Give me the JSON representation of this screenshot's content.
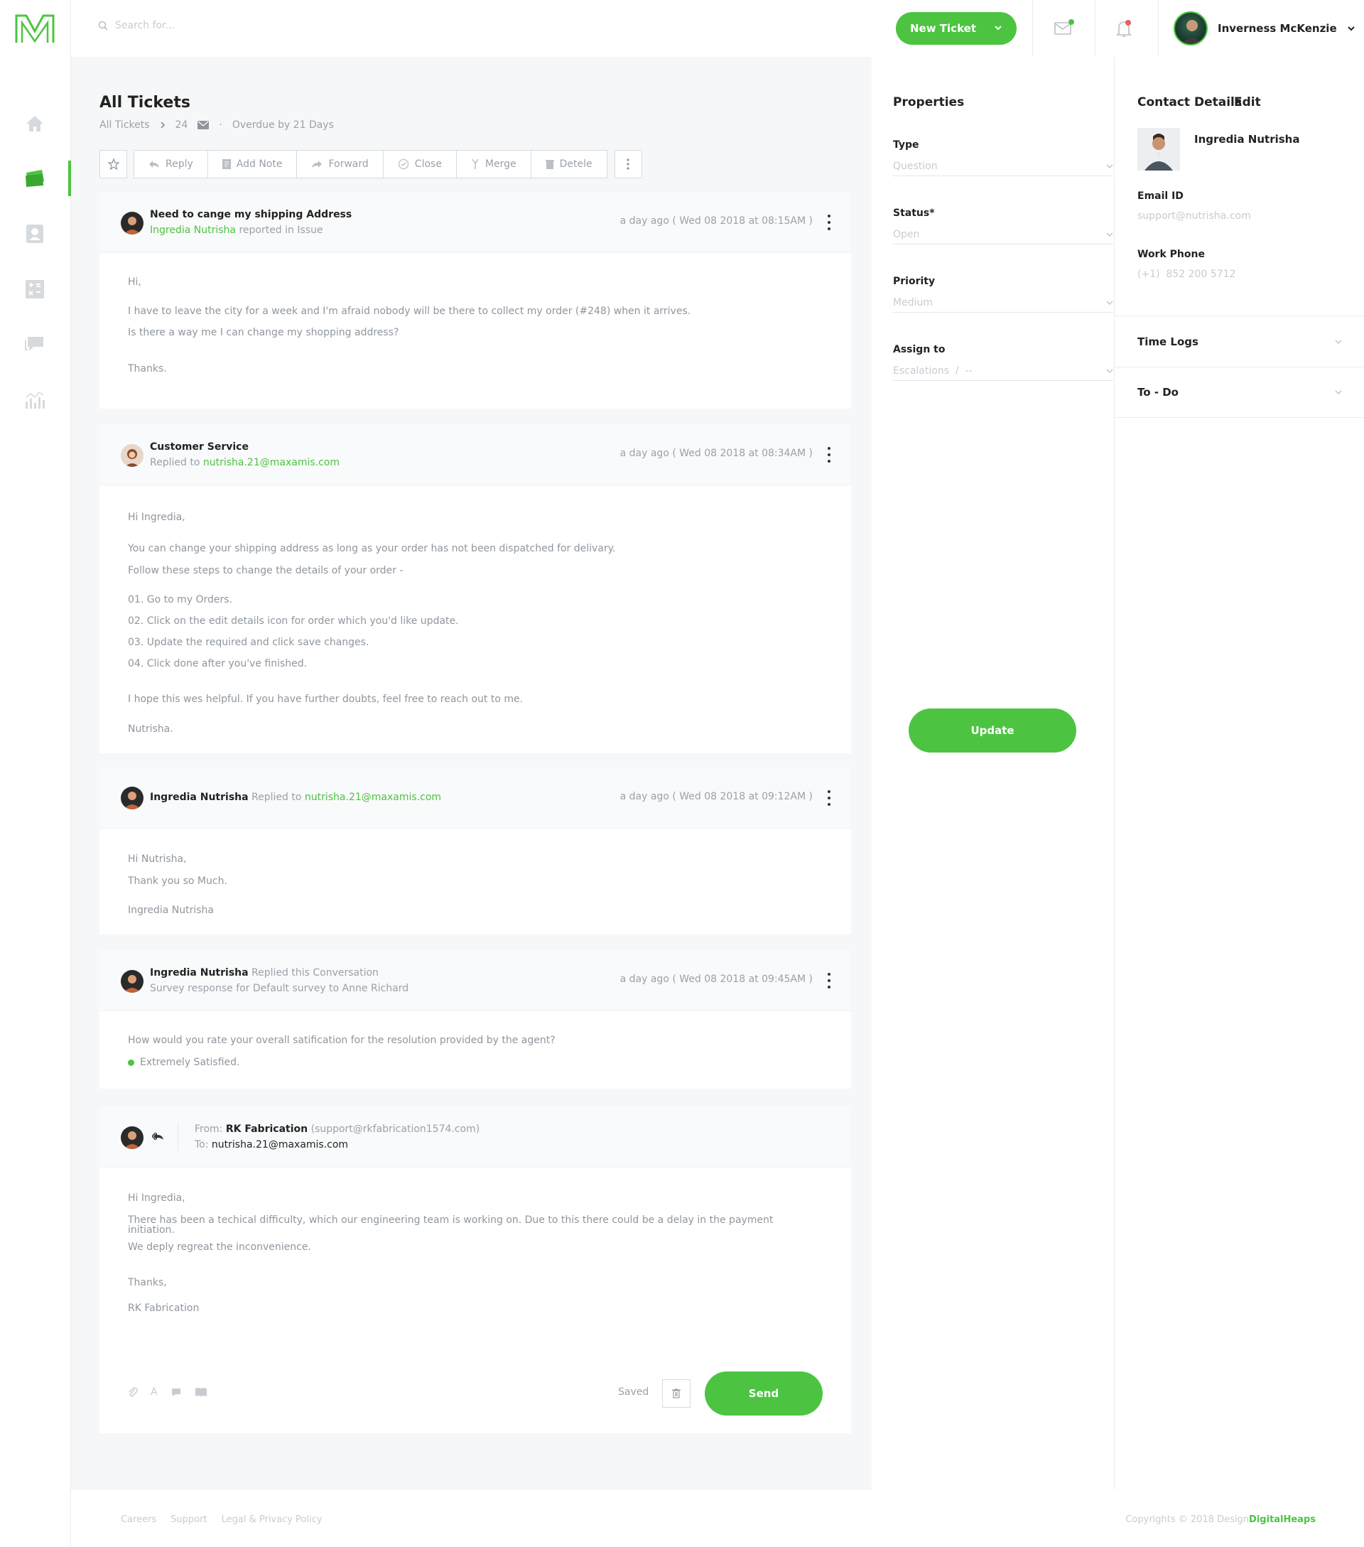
{
  "brand": {
    "accent": "#4cc441"
  },
  "rail": {
    "items": [
      {
        "name": "home-icon"
      },
      {
        "name": "tickets-icon",
        "active": true
      },
      {
        "name": "contacts-icon"
      },
      {
        "name": "integrations-icon"
      },
      {
        "name": "chat-icon"
      },
      {
        "name": "reports-icon"
      }
    ]
  },
  "topbar": {
    "search_placeholder": "Search for...",
    "new_ticket_label": "New Ticket",
    "user_name": "Inverness McKenzie"
  },
  "header": {
    "title": "All Tickets",
    "breadcrumb_root": "All Tickets",
    "ticket_number": "24",
    "overdue": "Overdue by 21 Days"
  },
  "toolbar": {
    "reply": "Reply",
    "add_note": "Add Note",
    "forward": "Forward",
    "close": "Close",
    "merge": "Merge",
    "delete": "Detele"
  },
  "thread": {
    "msg1": {
      "subject": "Need to cange my shipping Address",
      "author": "Ingredia Nutrisha",
      "action": "reported in Issue",
      "time": "a day ago ( Wed 08 2018 at 08:15AM )",
      "lines": [
        "Hi,",
        "I have to leave the city for a week and I'm afraid nobody will be there to collect my order (#248) when it arrives.",
        "Is there a way me I can change my shopping address?",
        "Thanks."
      ]
    },
    "msg2": {
      "author": "Customer Service",
      "action": "Replied to",
      "email": "nutrisha.21@maxamis.com",
      "time": "a day ago ( Wed 08 2018 at 08:34AM )",
      "greeting": "Hi Ingredia,",
      "intro1": "You can change your shipping address as long as your order has not been dispatched for delivary.",
      "intro2": "Follow these steps to change the details of your order -",
      "steps": [
        "01. Go to my Orders.",
        "02. Click on the edit details icon for order which you'd like update.",
        "03. Update the required and click save changes.",
        "04. Click done after you've finished."
      ],
      "outro": "I hope this wes helpful. If you have further doubts, feel free to reach out to me.",
      "sign": "Nutrisha."
    },
    "msg3": {
      "author": "Ingredia Nutrisha",
      "action": "Replied to",
      "email": "nutrisha.21@maxamis.com",
      "time": "a day ago ( Wed 08 2018 at 09:12AM )",
      "lines": [
        "Hi Nutrisha,",
        "Thank you so Much.",
        "Ingredia Nutrisha"
      ]
    },
    "msg4": {
      "author": "Ingredia Nutrisha",
      "action": "Replied this Conversation",
      "subline": "Survey response for Default survey to Anne Richard",
      "time": "a day ago ( Wed 08 2018 at 09:45AM )",
      "question": "How would you rate your overall satification for the resolution provided by the agent?",
      "answer": "Extremely Satisfied."
    },
    "compose": {
      "from_label": "From:",
      "from_name": "RK Fabrication",
      "from_email": "(support@rkfabrication1574.com)",
      "to_label": "To:",
      "to_email": "nutrisha.21@maxamis.com",
      "greeting": "Hi Ingredia,",
      "body1": "There has been a techical difficulty, which our engineering team is working on. Due to this there could be a delay in the payment initiation.",
      "body2": "We deply regreat the inconvenience.",
      "thanks": "Thanks,",
      "sign": "RK Fabrication",
      "saved": "Saved",
      "send": "Send"
    }
  },
  "properties": {
    "title": "Properties",
    "type_label": "Type",
    "type_value": "Question",
    "status_label": "Status*",
    "status_value": "Open",
    "priority_label": "Priority",
    "priority_value": "Medium",
    "assign_label": "Assign to",
    "assign_value": "Escalations  /  --",
    "update": "Update"
  },
  "contact": {
    "title": "Contact Details",
    "edit": "Edit",
    "name": "Ingredia Nutrisha",
    "email_label": "Email ID",
    "email": "support@nutrisha.com",
    "phone_label": "Work Phone",
    "phone": "(+1)  852 200 5712",
    "time_logs": "Time Logs",
    "todo": "To - Do"
  },
  "footer": {
    "careers": "Careers",
    "support": "Support",
    "legal": "Legal & Privacy Policy",
    "copyright": "Copyrights © 2018 Design",
    "company": "DigitalHeaps"
  }
}
